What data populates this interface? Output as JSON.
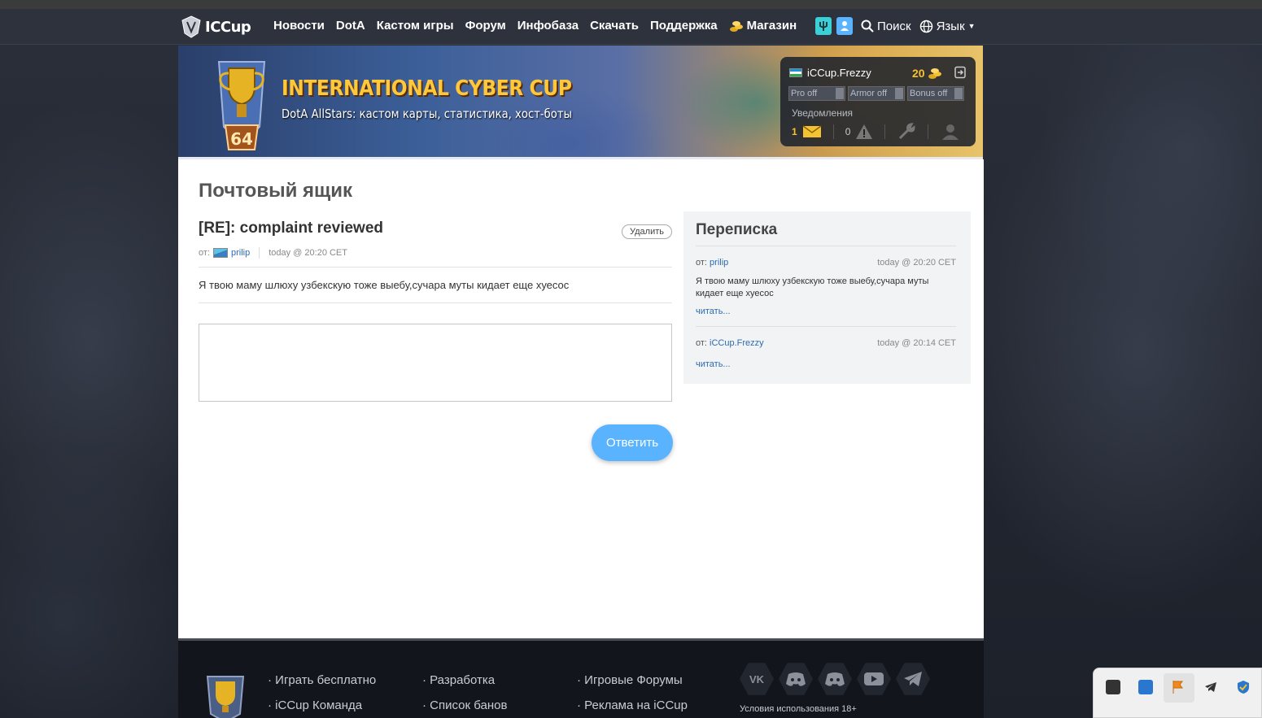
{
  "nav": {
    "logo": "ICCup",
    "items": [
      {
        "label": "Новости"
      },
      {
        "label": "DotA"
      },
      {
        "label": "Кастом игры"
      },
      {
        "label": "Форум"
      },
      {
        "label": "Инфобаза"
      },
      {
        "label": "Скачать"
      },
      {
        "label": "Поддержка"
      },
      {
        "label": "Магазин",
        "icon": "coins-icon"
      }
    ],
    "search": "Поиск",
    "language": "Язык"
  },
  "banner": {
    "title": "INTERNATIONAL CYBER CUP",
    "subtitle": "DotA AllStars: кастом карты, статистика, хост-боты",
    "level": "64"
  },
  "user_panel": {
    "username": "iCCup.Frezzy",
    "coins": "20",
    "toggles": [
      "Pro off",
      "Armor off",
      "Bonus off"
    ],
    "notifications_label": "Уведомления",
    "mail_count": "1",
    "warnings_count": "0"
  },
  "page": {
    "title": "Почтовый ящик"
  },
  "message": {
    "subject": "[RE]: complaint reviewed",
    "delete_label": "Удалить",
    "from_label": "от:",
    "from_user": "prilip",
    "date": "today @ 20:20 CET",
    "body": "Я твою маму шлюху узбекскую тоже выебу,сучара муты кидает еще хуесос",
    "reply_label": "Ответить"
  },
  "conversation": {
    "title": "Переписка",
    "items": [
      {
        "from_label": "от:",
        "from_user": "prilip",
        "date": "today @ 20:20 CET",
        "text": "Я твою маму шлюху узбекскую тоже выебу,сучара муты кидает еще хуесос",
        "read": "читать..."
      },
      {
        "from_label": "от:",
        "from_user": "iCCup.Frezzy",
        "date": "today @ 20:14 CET",
        "text": "",
        "read": "читать..."
      }
    ]
  },
  "footer": {
    "col1": [
      "· Играть бесплатно",
      "· iCCup Команда"
    ],
    "col2": [
      "· Разработка",
      "· Список банов"
    ],
    "col3": [
      "· Игровые Форумы",
      "· Реклама на iCCup"
    ],
    "social": [
      "vk-icon",
      "discord-icon",
      "discord-settings-icon",
      "youtube-icon",
      "telegram-icon"
    ],
    "terms": "Условия использования 18+"
  },
  "colors": {
    "accent": "#5ab3ff",
    "gold": "#f5c232",
    "link": "#2c6cb0"
  }
}
